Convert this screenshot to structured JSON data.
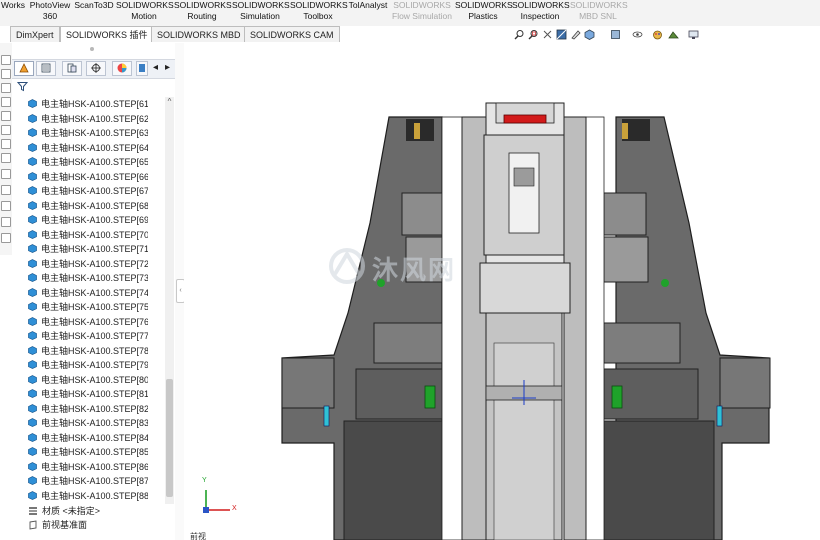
{
  "ribbon": {
    "items": [
      {
        "line1": "Works",
        "line2": "",
        "disabled": false
      },
      {
        "line1": "PhotoView",
        "line2": "360",
        "disabled": false
      },
      {
        "line1": "ScanTo3D",
        "line2": "",
        "disabled": false
      },
      {
        "line1": "SOLIDWORKS",
        "line2": "Motion",
        "disabled": false
      },
      {
        "line1": "SOLIDWORKS",
        "line2": "Routing",
        "disabled": false
      },
      {
        "line1": "SOLIDWORKS",
        "line2": "Simulation",
        "disabled": false
      },
      {
        "line1": "SOLIDWORKS",
        "line2": "Toolbox",
        "disabled": false
      },
      {
        "line1": "TolAnalyst",
        "line2": "",
        "disabled": false
      },
      {
        "line1": "SOLIDWORKS",
        "line2": "Flow Simulation",
        "disabled": true
      },
      {
        "line1": "SOLIDWORKS",
        "line2": "Plastics",
        "disabled": false
      },
      {
        "line1": "SOLIDWORKS",
        "line2": "Inspection",
        "disabled": false
      },
      {
        "line1": "SOLIDWORKS",
        "line2": "MBD SNL",
        "disabled": true
      }
    ]
  },
  "tabs": [
    {
      "label": "DimXpert",
      "active": false
    },
    {
      "label": "SOLIDWORKS 插件",
      "active": true
    },
    {
      "label": "SOLIDWORKS MBD",
      "active": false
    },
    {
      "label": "SOLIDWORKS CAM",
      "active": false
    }
  ],
  "feature_tree": {
    "filter_icon": "funnel-icon",
    "item_prefix": "电主轴HSK-A100.STEP[",
    "items": [
      "电主轴HSK-A100.STEP[61",
      "电主轴HSK-A100.STEP[62",
      "电主轴HSK-A100.STEP[63",
      "电主轴HSK-A100.STEP[64",
      "电主轴HSK-A100.STEP[65",
      "电主轴HSK-A100.STEP[66",
      "电主轴HSK-A100.STEP[67",
      "电主轴HSK-A100.STEP[68",
      "电主轴HSK-A100.STEP[69",
      "电主轴HSK-A100.STEP[70",
      "电主轴HSK-A100.STEP[71",
      "电主轴HSK-A100.STEP[72",
      "电主轴HSK-A100.STEP[73",
      "电主轴HSK-A100.STEP[74",
      "电主轴HSK-A100.STEP[75",
      "电主轴HSK-A100.STEP[76",
      "电主轴HSK-A100.STEP[77",
      "电主轴HSK-A100.STEP[78",
      "电主轴HSK-A100.STEP[79",
      "电主轴HSK-A100.STEP[80",
      "电主轴HSK-A100.STEP[81",
      "电主轴HSK-A100.STEP[82",
      "电主轴HSK-A100.STEP[83",
      "电主轴HSK-A100.STEP[84",
      "电主轴HSK-A100.STEP[85",
      "电主轴HSK-A100.STEP[86",
      "电主轴HSK-A100.STEP[87",
      "电主轴HSK-A100.STEP[88"
    ],
    "material": "材质 <未指定>",
    "front_plane": "前视基准面"
  },
  "viewport": {
    "view_label": "前视",
    "watermark": "沐风网",
    "axis_x": "X",
    "axis_y": "Y"
  },
  "colors": {
    "part_cube": "#2f8fd6",
    "green_part": "#1fa22a",
    "red_part": "#d21a1a",
    "cyan_pin": "#2fc1d6",
    "body_dark": "#4a4a4a"
  }
}
